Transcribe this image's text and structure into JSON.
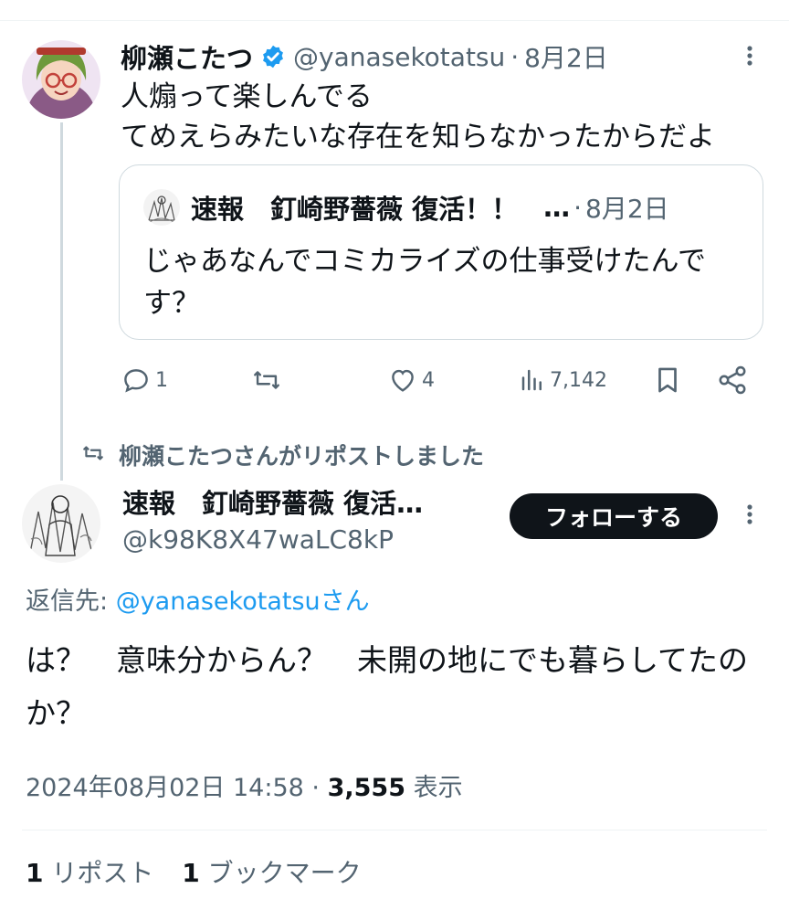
{
  "quoted_tweet": {
    "author_name": "柳瀬こたつ",
    "handle": "@yanasekotatsu",
    "date": "8月2日",
    "text_lines": [
      "人煽って楽しんでる",
      "てめえらみたいな存在を知らなかったからだよ"
    ],
    "quote": {
      "author_name": "速報　釘崎野薔薇 復活！！",
      "ellipsis": "…",
      "date": "8月2日",
      "text": "じゃあなんでコミカライズの仕事受けたんです？"
    },
    "actions": {
      "reply_count": "1",
      "retweet_count": "",
      "like_count": "4",
      "view_count": "7,142"
    }
  },
  "repost_note": "柳瀬こたつさんがリポストしました",
  "main_tweet": {
    "author_name": "速報　釘崎野薔薇 復活…",
    "handle": "@k98K8X47waLC8kP",
    "follow_label": "フォローする",
    "reply_prefix": "返信先: ",
    "reply_mention": "@yanasekotatsu",
    "reply_suffix": "さん",
    "text": "は？　意味分からん？　未開の地にでも暮らしてたのか？",
    "timestamp": "2024年08月02日 14:58",
    "separator": " · ",
    "views_count": "3,555",
    "views_label": " 表示",
    "repost_count": "1",
    "repost_label": " リポスト",
    "bookmark_count": "1",
    "bookmark_label": " ブックマーク"
  },
  "colors": {
    "text": "#0f1419",
    "secondary": "#536471",
    "link": "#1d9bf0",
    "verified": "#1d9bf0",
    "border": "#cfd9de"
  },
  "icons": [
    "verified-badge-icon",
    "more-icon",
    "reply-icon",
    "retweet-icon",
    "like-icon",
    "views-icon",
    "bookmark-icon",
    "share-icon"
  ]
}
